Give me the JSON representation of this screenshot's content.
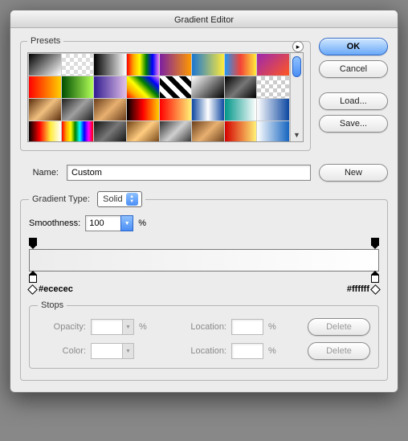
{
  "title": "Gradient Editor",
  "presets": {
    "legend": "Presets",
    "swatches": [
      "linear-gradient(135deg,#000,#fff)",
      "repeating-conic-gradient(#ddd 0 25%,#fff 0 50%) 0 0/10px 10px",
      "linear-gradient(90deg,#000,#fff)",
      "linear-gradient(90deg,red,orange,yellow,green,blue,violet)",
      "linear-gradient(90deg,#7b1fa2,#ff9800)",
      "linear-gradient(90deg,#1976d2,#ffeb3b)",
      "linear-gradient(90deg,#2196f3,#f44336,#ffeb3b)",
      "linear-gradient(135deg,#9c27b0,#ff5722)",
      "linear-gradient(90deg,#ff0000,#ffd000)",
      "linear-gradient(90deg,#004d00,#b2ff59)",
      "linear-gradient(90deg,#311b92,#e1bee7)",
      "linear-gradient(45deg,red,orange,yellow,green,blue,violet)",
      "repeating-linear-gradient(45deg,#000 0 6px,#fff 6px 12px)",
      "linear-gradient(135deg,#fff,#000)",
      "linear-gradient(135deg,#000,#777,#000)",
      "repeating-conic-gradient(#ccc 0 25%,#fff 0 50%) 0 0/10px 10px",
      "linear-gradient(135deg,#5a2d0c,#f0c080,#5a2d0c)",
      "linear-gradient(135deg,#202020,#a0a0a0,#202020)",
      "linear-gradient(135deg,#6a3e1b,#e8b070,#6a3e1b)",
      "linear-gradient(90deg,#000,#ff0000,#ffd000)",
      "linear-gradient(90deg,#ff0000,#fff176)",
      "linear-gradient(90deg,#0d47a1,#fff,#0d47a1)",
      "linear-gradient(90deg,#009688,#fff)",
      "linear-gradient(90deg,#fff,#0d47a1)",
      "linear-gradient(90deg,#000,#ff0000,#ffeb3b,#fff)",
      "linear-gradient(90deg,red,orange,yellow,green,cyan,blue,magenta,red)",
      "linear-gradient(135deg,#111,#777,#111)",
      "linear-gradient(135deg,#704214,#ffcc80,#704214)",
      "linear-gradient(135deg,#303030,#d0d0d0,#303030)",
      "linear-gradient(135deg,#6a3e1b,#e8b070,#6a3e1b)",
      "linear-gradient(90deg,#d50000,#fff176)",
      "linear-gradient(90deg,#fff,#1565c0)"
    ]
  },
  "buttons": {
    "ok": "OK",
    "cancel": "Cancel",
    "load": "Load...",
    "save": "Save...",
    "new": "New",
    "delete": "Delete"
  },
  "name": {
    "label": "Name:",
    "value": "Custom"
  },
  "gradientType": {
    "legend": "Gradient Type:",
    "value": "Solid",
    "smoothLabel": "Smoothness:",
    "smoothValue": "100",
    "pct": "%",
    "leftHex": "#ececec",
    "rightHex": "#ffffff"
  },
  "stops": {
    "legend": "Stops",
    "opacityLabel": "Opacity:",
    "colorLabel": "Color:",
    "locationLabel": "Location:",
    "pct": "%",
    "opacityValue": "",
    "opacityLocation": "",
    "colorLocation": ""
  }
}
